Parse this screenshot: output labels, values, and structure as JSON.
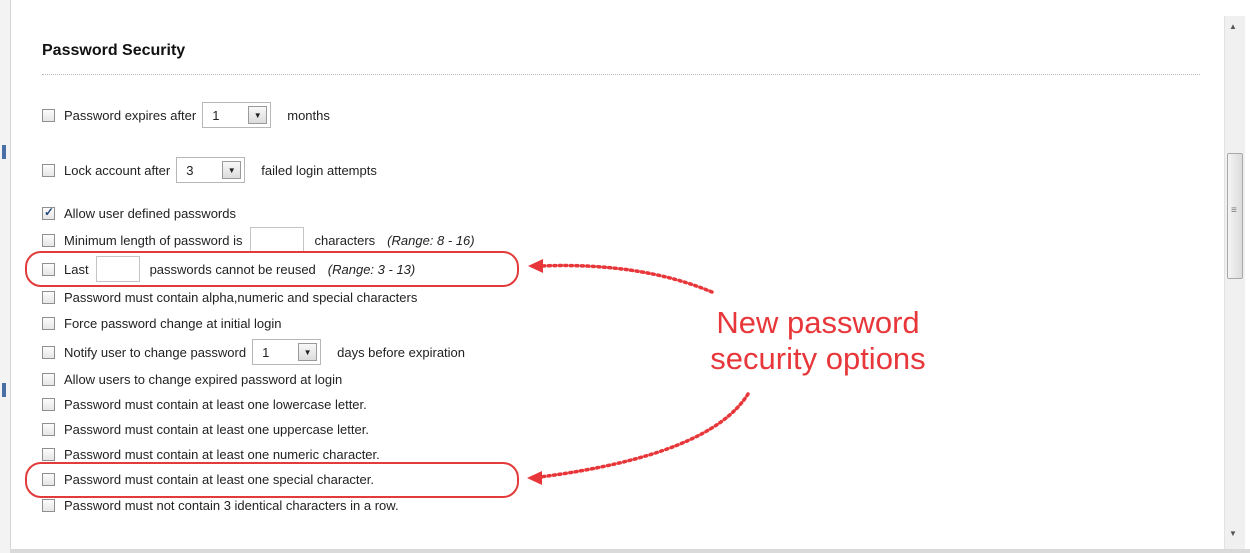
{
  "section": {
    "title": "Password Security"
  },
  "options": {
    "expires": {
      "label_before": "Password expires after",
      "value": "1",
      "label_after": "months",
      "checked": false
    },
    "lock": {
      "label_before": "Lock account after",
      "value": "3",
      "label_after": "failed login attempts",
      "checked": false
    },
    "allow_user_defined": {
      "label": "Allow user defined passwords",
      "checked": true
    },
    "min_length": {
      "label_before": "Minimum length of password is",
      "value": "",
      "label_after": "characters",
      "range": "(Range: 8 - 16)",
      "checked": false
    },
    "last_reused": {
      "label_before": "Last",
      "value": "",
      "label_after": "passwords cannot be reused",
      "range": "(Range: 3 - 13)",
      "checked": false
    },
    "alpha_numeric_special": {
      "label": "Password must contain alpha,numeric and special characters",
      "checked": false
    },
    "force_change": {
      "label": "Force password change at initial login",
      "checked": false
    },
    "notify": {
      "label_before": "Notify user to change password",
      "value": "1",
      "label_after": "days before expiration",
      "checked": false
    },
    "allow_expired_change": {
      "label": "Allow users to change expired password at login",
      "checked": false
    },
    "lowercase": {
      "label": "Password must contain at least one lowercase letter.",
      "checked": false
    },
    "uppercase": {
      "label": "Password must contain at least one uppercase letter.",
      "checked": false
    },
    "numeric": {
      "label": "Password must contain at least one numeric character.",
      "checked": false
    },
    "special": {
      "label": "Password must contain at least one special character.",
      "checked": false
    },
    "identical": {
      "label": "Password must not contain 3 identical characters in a row.",
      "checked": false
    }
  },
  "annotation": {
    "line1": "New password",
    "line2": "security options"
  },
  "colors": {
    "annotation": "#e8373a",
    "checkmark": "#2a4c7e"
  }
}
